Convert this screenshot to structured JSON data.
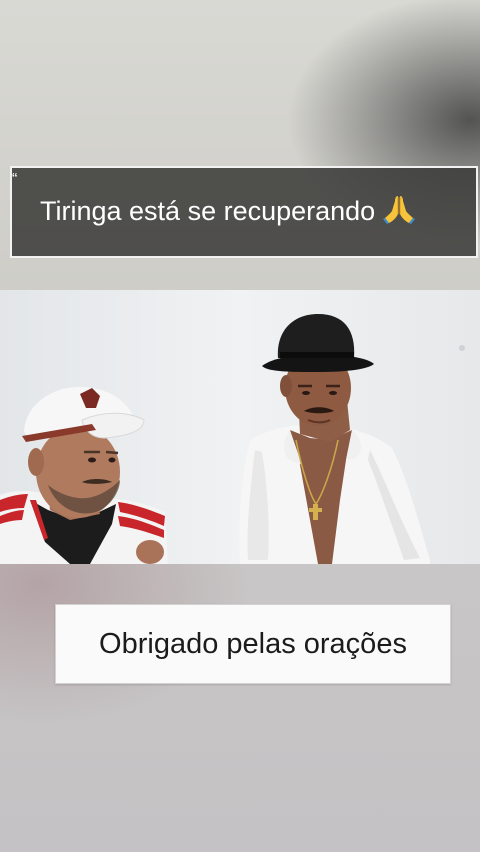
{
  "captions": {
    "top": {
      "quote_mark": "“",
      "text": "Tiringa está se recuperando",
      "emoji": "praying-hands-emoji"
    },
    "bottom": {
      "text": "Obrigado pelas orações"
    }
  },
  "video": {
    "subjects": [
      "man-in-white-cap",
      "man-in-black-hat"
    ]
  },
  "colors": {
    "caption_top_bg": "#3c3c3a",
    "caption_top_text": "#ffffff",
    "caption_bottom_bg": "#fafafa",
    "caption_bottom_text": "#1b1b1b"
  }
}
